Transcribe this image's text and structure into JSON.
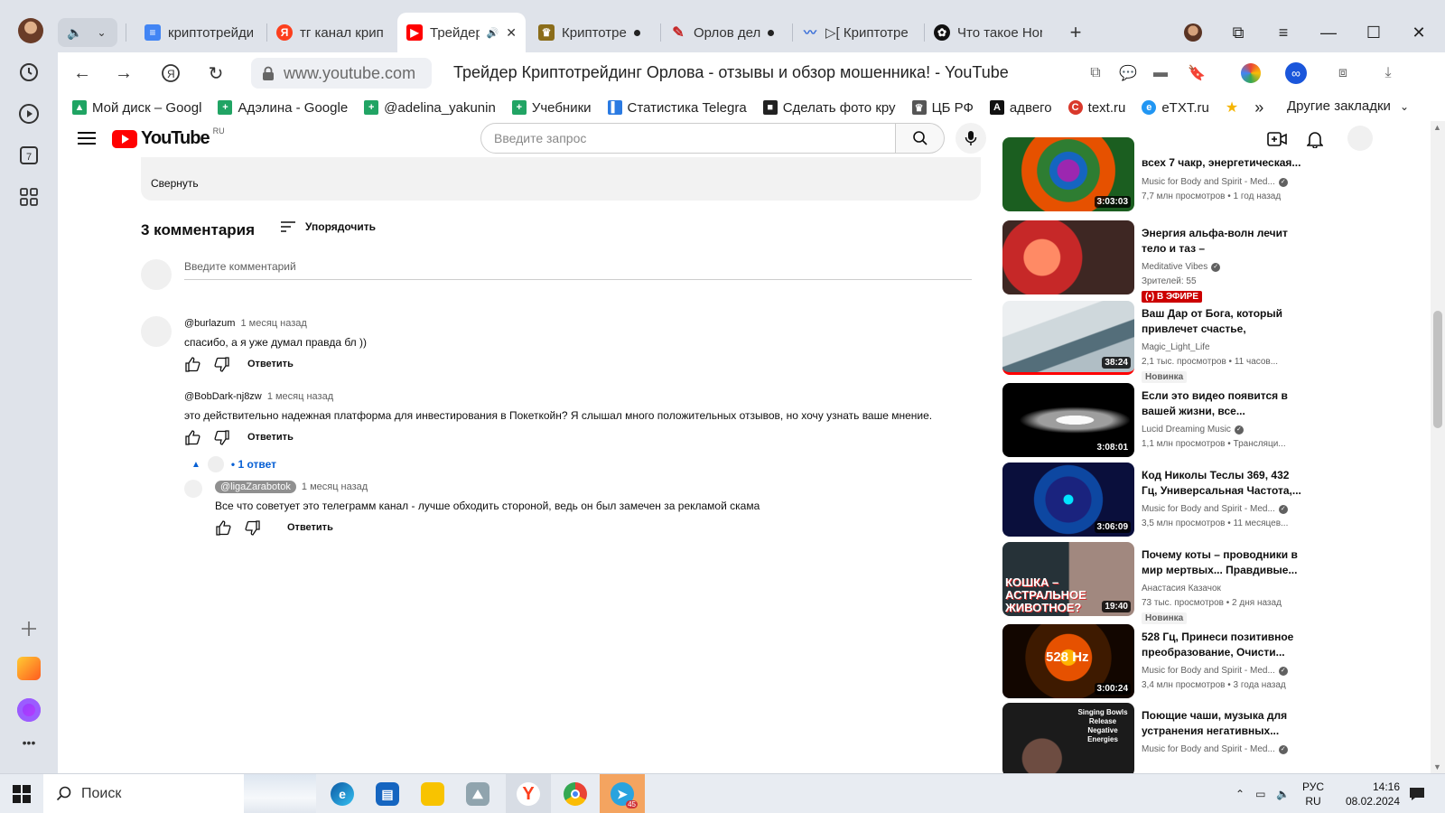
{
  "browser": {
    "tabs": [
      {
        "label": "криптотрейди",
        "icon": "google-docs-icon"
      },
      {
        "label": "тг канал крип",
        "icon": "yandex-icon"
      },
      {
        "label": "Трейдер",
        "icon": "youtube-icon",
        "active": true
      },
      {
        "label": "Криптотре",
        "icon": "trophy-icon"
      },
      {
        "label": "Орлов дел",
        "icon": "pen-icon"
      },
      {
        "label": "▷[ Криптотре",
        "icon": "audio-wave-icon"
      },
      {
        "label": "Что такое Hor",
        "icon": "openai-icon"
      }
    ],
    "url": "www.youtube.com",
    "page_title": "Трейдер Криптотрейдинг Орлова - отзывы и обзор мошенника! - YouTube",
    "bookmarks": [
      {
        "label": "Мой диск – Googl",
        "color": "#1fa463",
        "glyph": "▲"
      },
      {
        "label": "Адэлина - Google",
        "color": "#21a464",
        "glyph": "+"
      },
      {
        "label": "@adelina_yakunin",
        "color": "#21a464",
        "glyph": "+"
      },
      {
        "label": "Учебники",
        "color": "#21a464",
        "glyph": "+"
      },
      {
        "label": "Статистика Telegra",
        "color": "#2a7ae2",
        "glyph": "▌"
      },
      {
        "label": "Сделать фото кру",
        "color": "#222222",
        "glyph": "■"
      },
      {
        "label": "ЦБ РФ",
        "color": "#555555",
        "glyph": "♛"
      },
      {
        "label": "адвего",
        "color": "#111111",
        "glyph": "A"
      },
      {
        "label": "text.ru",
        "color": "#d9382b",
        "glyph": "C"
      },
      {
        "label": "eTXT.ru",
        "color": "#2196f3",
        "glyph": "e"
      }
    ],
    "bookmarks_more": "»",
    "other_bookmarks": "Другие закладки"
  },
  "youtube": {
    "logo_text": "YouTube",
    "country_code": "RU",
    "search_placeholder": "Введите запрос",
    "collapse_label": "Свернуть",
    "comments_count": "3 комментария",
    "sort_label": "Упорядочить",
    "add_comment_placeholder": "Введите комментарий",
    "reply_label": "Ответить",
    "replies_toggle": "• 1 ответ",
    "comments": [
      {
        "author": "@burlazum",
        "time": "1 месяц назад",
        "text": "спасибо, а я уже думал правда бл ))"
      },
      {
        "author": "@BobDark-nj8zw",
        "time": "1 месяц назад",
        "text": "это действительно надежная платформа для инвестирования в Покеткойн? Я слышал много положительных отзывов, но хочу узнать ваше мнение."
      }
    ],
    "reply": {
      "author": "@ligaZarabotok",
      "time": "1 месяц назад",
      "text": "Все что советует это телеграмм канал - лучше обходить стороной, ведь он был замечен за рекламой скама"
    },
    "recommendations": [
      {
        "title": "всех 7 чакр, энергетическая...",
        "channel": "Music for Body and Spirit - Med...",
        "verified": true,
        "stats": "7,7 млн просмотров • 1 год назад",
        "duration": "3:03:03",
        "thumb_colors": [
          "#1b5e20",
          "#e65100",
          "#6a1b9a"
        ]
      },
      {
        "title": "Энергия альфа-волн лечит тело и таз – высвобождение...",
        "channel": "Meditative Vibes",
        "verified": true,
        "stats": "Зрителей: 55",
        "badge_live": "(•) В ЭФИРЕ",
        "thumb_colors": [
          "#b71c1c",
          "#ff7043",
          "#4e342e"
        ]
      },
      {
        "title": "Ваш Дар от Бога, который привлечет счастье, финансы...",
        "channel": "Magic_Light_Life",
        "verified": false,
        "stats": "2,1 тыс. просмотров • 11 часов...",
        "duration": "38:24",
        "badge": "Новинка",
        "thumb_colors": [
          "#cfd8dc",
          "#37474f",
          "#90a4ae"
        ]
      },
      {
        "title": "Если это видео появится в вашей жизни, все...",
        "channel": "Lucid Dreaming Music",
        "verified": true,
        "stats": "1,1 млн просмотров • Трансляци...",
        "duration": "3:08:01",
        "thumb_colors": [
          "#000000",
          "#e0e0e0",
          "#212121"
        ]
      },
      {
        "title": "Код Николы Теслы 369, 432 Гц, Универсальная Частота,...",
        "channel": "Music for Body and Spirit - Med...",
        "verified": true,
        "stats": "3,5 млн просмотров • 11 месяцев...",
        "duration": "3:06:09",
        "thumb_colors": [
          "#0d1b5e",
          "#00bcd4",
          "#1a237e"
        ]
      },
      {
        "title": "Почему коты – проводники в мир мертвых... Правдивые...",
        "channel": "Анастасия Казачок",
        "verified": false,
        "stats": "73 тыс. просмотров • 2 дня назад",
        "duration": "19:40",
        "badge": "Новинка",
        "thumb_colors": [
          "#263238",
          "#d32f2f",
          "#8d6e63"
        ],
        "thumb_caption": "КОШКА – АСТРАЛЬНОЕ ЖИВОТНОЕ?"
      },
      {
        "title": "528 Гц, Принеси позитивное преобразование, Очисти...",
        "channel": "Music for Body and Spirit - Med...",
        "verified": true,
        "stats": "3,4 млн просмотров • 3 года назад",
        "duration": "3:00:24",
        "thumb_colors": [
          "#3e1a00",
          "#ff8f00",
          "#1a0a00"
        ],
        "thumb_caption": "528 Hz"
      },
      {
        "title": "Поющие чаши, музыка для устранения негативных...",
        "channel": "Music for Body and Spirit - Med...",
        "verified": true,
        "stats": "",
        "thumb_colors": [
          "#1b1b1b",
          "#424242",
          "#000000"
        ],
        "thumb_caption": "Singing Bowls Release Negative Energies"
      }
    ]
  },
  "taskbar": {
    "search_label": "Поиск",
    "telegram_badge": "45",
    "lang_top": "РУС",
    "lang_bottom": "RU",
    "time": "14:16",
    "date": "08.02.2024"
  }
}
